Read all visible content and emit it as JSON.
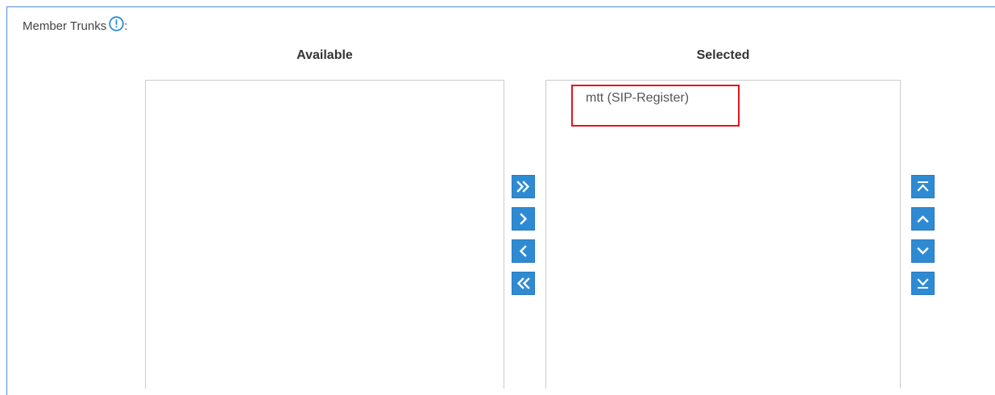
{
  "field": {
    "label": "Member Trunks",
    "colon": ":",
    "info_icon": "info-circle-icon"
  },
  "available": {
    "header": "Available",
    "items": []
  },
  "selected": {
    "header": "Selected",
    "items": [
      "mtt (SIP-Register)"
    ]
  },
  "transfer_buttons": [
    {
      "name": "add-all",
      "icon": "double-chevron-right-icon"
    },
    {
      "name": "add",
      "icon": "chevron-right-icon"
    },
    {
      "name": "remove",
      "icon": "chevron-left-icon"
    },
    {
      "name": "remove-all",
      "icon": "double-chevron-left-icon"
    }
  ],
  "order_buttons": [
    {
      "name": "move-top",
      "icon": "arrow-to-top-icon"
    },
    {
      "name": "move-up",
      "icon": "chevron-up-icon"
    },
    {
      "name": "move-down",
      "icon": "chevron-down-icon"
    },
    {
      "name": "move-bottom",
      "icon": "arrow-to-bottom-icon"
    }
  ],
  "colors": {
    "frame_border": "#4a90d9",
    "button_bg": "#2e8bd3",
    "highlight": "#e5141a"
  }
}
